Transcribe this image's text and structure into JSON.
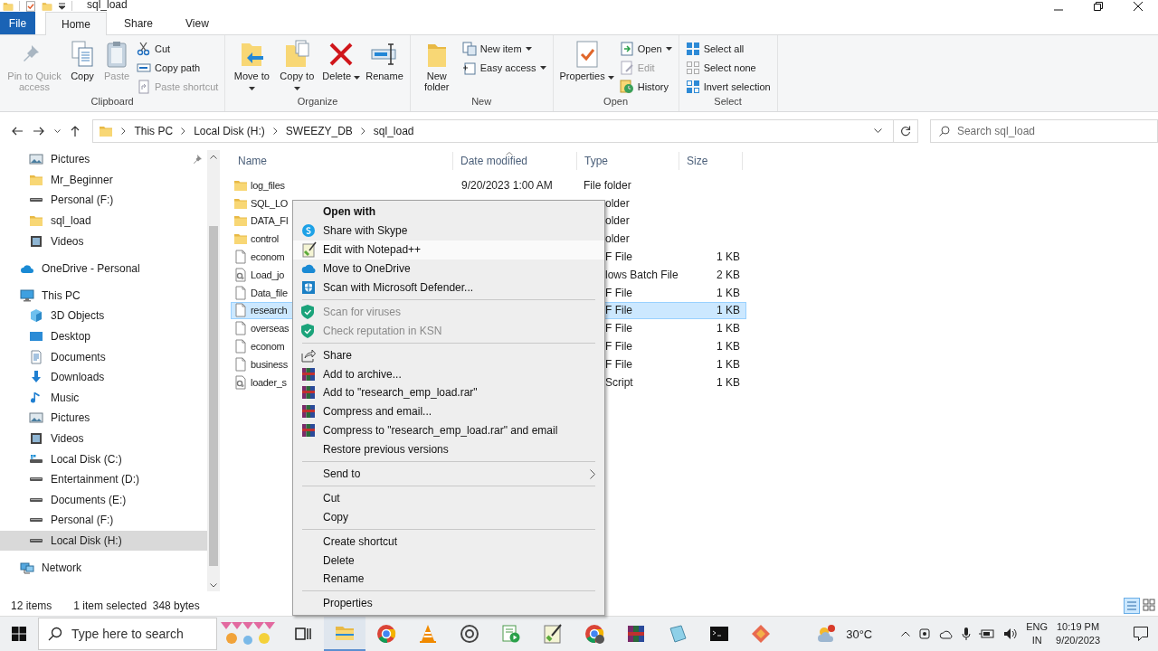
{
  "window": {
    "title": "sql_load"
  },
  "tabs": [
    {
      "label": "File",
      "kind": "file",
      "selected": false
    },
    {
      "label": "Home",
      "kind": "tab",
      "selected": true
    },
    {
      "label": "Share",
      "kind": "tab",
      "selected": false
    },
    {
      "label": "View",
      "kind": "tab",
      "selected": false
    }
  ],
  "ribbon": [
    {
      "label": "Clipboard",
      "items": [
        {
          "kind": "large",
          "label": "Pin to Quick access",
          "disabled": true,
          "dropdown": false
        },
        {
          "kind": "large",
          "label": "Copy",
          "disabled": false,
          "dropdown": false
        },
        {
          "kind": "large",
          "label": "Paste",
          "disabled": true,
          "dropdown": false
        },
        {
          "kind": "small",
          "label": "Cut",
          "disabled": false,
          "dropdown": false
        },
        {
          "kind": "small",
          "label": "Copy path",
          "disabled": false,
          "dropdown": false
        },
        {
          "kind": "small",
          "label": "Paste shortcut",
          "disabled": true,
          "dropdown": false
        }
      ]
    },
    {
      "label": "Organize",
      "items": [
        {
          "kind": "large",
          "label": "Move to",
          "disabled": false,
          "dropdown": true
        },
        {
          "kind": "large",
          "label": "Copy to",
          "disabled": false,
          "dropdown": true
        },
        {
          "kind": "large",
          "label": "Delete",
          "disabled": false,
          "dropdown": true
        },
        {
          "kind": "large",
          "label": "Rename",
          "disabled": false,
          "dropdown": false
        }
      ]
    },
    {
      "label": "New",
      "items": [
        {
          "kind": "large",
          "label": "New folder",
          "disabled": false,
          "dropdown": false
        },
        {
          "kind": "small",
          "label": "New item",
          "disabled": false,
          "dropdown": true
        },
        {
          "kind": "small",
          "label": "Easy access",
          "disabled": false,
          "dropdown": true
        }
      ]
    },
    {
      "label": "Open",
      "items": [
        {
          "kind": "large",
          "label": "Properties",
          "disabled": false,
          "dropdown": true
        },
        {
          "kind": "small",
          "label": "Open",
          "disabled": false,
          "dropdown": true
        },
        {
          "kind": "small",
          "label": "Edit",
          "disabled": true,
          "dropdown": false
        },
        {
          "kind": "small",
          "label": "History",
          "disabled": false,
          "dropdown": false
        }
      ]
    },
    {
      "label": "Select",
      "items": [
        {
          "kind": "small",
          "label": "Select all",
          "disabled": false,
          "dropdown": false
        },
        {
          "kind": "small",
          "label": "Select none",
          "disabled": false,
          "dropdown": false
        },
        {
          "kind": "small",
          "label": "Invert selection",
          "disabled": false,
          "dropdown": false
        }
      ]
    }
  ],
  "address": {
    "crumbs": [
      "This PC",
      "Local Disk (H:)",
      "SWEEZY_DB",
      "sql_load"
    ],
    "search_placeholder": "Search sql_load"
  },
  "nav": [
    {
      "children": [
        {
          "label": "Pictures",
          "pinned": true,
          "selected": false
        },
        {
          "label": "Mr_Beginner",
          "pinned": false,
          "selected": false
        },
        {
          "label": "Personal (F:)",
          "pinned": false,
          "selected": false
        },
        {
          "label": "sql_load",
          "pinned": false,
          "selected": false
        },
        {
          "label": "Videos",
          "pinned": false,
          "selected": false
        }
      ]
    },
    {
      "label": "OneDrive - Personal",
      "selected": false
    },
    {
      "label": "This PC",
      "selected": false,
      "children": [
        {
          "label": "3D Objects",
          "selected": false
        },
        {
          "label": "Desktop",
          "selected": false
        },
        {
          "label": "Documents",
          "selected": false
        },
        {
          "label": "Downloads",
          "selected": false
        },
        {
          "label": "Music",
          "selected": false
        },
        {
          "label": "Pictures",
          "selected": false
        },
        {
          "label": "Videos",
          "selected": false
        },
        {
          "label": "Local Disk (C:)",
          "selected": false
        },
        {
          "label": "Entertainment (D:)",
          "selected": false
        },
        {
          "label": "Documents (E:)",
          "selected": false
        },
        {
          "label": "Personal (F:)",
          "selected": false
        },
        {
          "label": "Local Disk (H:)",
          "selected": true
        }
      ]
    },
    {
      "label": "Network",
      "selected": false
    }
  ],
  "columns": [
    {
      "label": "Name",
      "sorted": false
    },
    {
      "label": "Date modified",
      "sorted": true
    },
    {
      "label": "Type",
      "sorted": false
    },
    {
      "label": "Size",
      "sorted": false
    }
  ],
  "files": [
    {
      "kind": "folder",
      "name": "log_files",
      "date": "9/20/2023 1:00 AM",
      "type": "File folder",
      "selected": false
    },
    {
      "kind": "folder",
      "name": "SQL_LO",
      "type": "older",
      "selected": false
    },
    {
      "kind": "folder",
      "name": "DATA_FI",
      "type": "older",
      "selected": false
    },
    {
      "kind": "folder",
      "name": "control",
      "type": "older",
      "selected": false
    },
    {
      "kind": "file",
      "name": "econom",
      "type": "F File",
      "size": "1 KB",
      "selected": false
    },
    {
      "kind": "batch",
      "name": "Load_jo",
      "type": "lows Batch File",
      "size": "2 KB",
      "selected": false
    },
    {
      "kind": "file",
      "name": "Data_file",
      "type": "F File",
      "size": "1 KB",
      "selected": false
    },
    {
      "kind": "file",
      "name": "research",
      "type": "F File",
      "size": "1 KB",
      "selected": true
    },
    {
      "kind": "file",
      "name": "overseas",
      "type": "F File",
      "size": "1 KB",
      "selected": false
    },
    {
      "kind": "file",
      "name": "econom",
      "type": "F File",
      "size": "1 KB",
      "selected": false
    },
    {
      "kind": "file",
      "name": "business",
      "type": "F File",
      "size": "1 KB",
      "selected": false
    },
    {
      "kind": "batch",
      "name": "loader_s",
      "type": "Script",
      "size": "1 KB",
      "selected": false
    }
  ],
  "context_menu": [
    {
      "kind": "item",
      "label": "Open with",
      "default": true,
      "disabled": false,
      "selected": false
    },
    {
      "kind": "item",
      "label": "Share with Skype",
      "default": false,
      "disabled": false,
      "selected": false
    },
    {
      "kind": "item",
      "label": "Edit with Notepad++",
      "default": false,
      "disabled": false,
      "selected": true
    },
    {
      "kind": "item",
      "label": "Move to OneDrive",
      "default": false,
      "disabled": false,
      "selected": false
    },
    {
      "kind": "item",
      "label": "Scan with Microsoft Defender...",
      "default": false,
      "disabled": false,
      "selected": false
    },
    {
      "kind": "separator"
    },
    {
      "kind": "item",
      "label": "Scan for viruses",
      "default": false,
      "disabled": true,
      "selected": false
    },
    {
      "kind": "item",
      "label": "Check reputation in KSN",
      "default": false,
      "disabled": true,
      "selected": false
    },
    {
      "kind": "separator"
    },
    {
      "kind": "item",
      "label": "Share",
      "default": false,
      "disabled": false,
      "selected": false
    },
    {
      "kind": "item",
      "label": "Add to archive...",
      "default": false,
      "disabled": false,
      "selected": false
    },
    {
      "kind": "item",
      "label": "Add to \"research_emp_load.rar\"",
      "default": false,
      "disabled": false,
      "selected": false
    },
    {
      "kind": "item",
      "label": "Compress and email...",
      "default": false,
      "disabled": false,
      "selected": false
    },
    {
      "kind": "item",
      "label": "Compress to \"research_emp_load.rar\" and email",
      "default": false,
      "disabled": false,
      "selected": false
    },
    {
      "kind": "item",
      "label": "Restore previous versions",
      "default": false,
      "disabled": false,
      "selected": false
    },
    {
      "kind": "separator"
    },
    {
      "kind": "submenu",
      "label": "Send to",
      "default": false,
      "disabled": false,
      "selected": false
    },
    {
      "kind": "separator"
    },
    {
      "kind": "item",
      "label": "Cut",
      "default": false,
      "disabled": false,
      "selected": false
    },
    {
      "kind": "item",
      "label": "Copy",
      "default": false,
      "disabled": false,
      "selected": false
    },
    {
      "kind": "separator"
    },
    {
      "kind": "item",
      "label": "Create shortcut",
      "default": false,
      "disabled": false,
      "selected": false
    },
    {
      "kind": "item",
      "label": "Delete",
      "default": false,
      "disabled": false,
      "selected": false
    },
    {
      "kind": "item",
      "label": "Rename",
      "default": false,
      "disabled": false,
      "selected": false
    },
    {
      "kind": "separator"
    },
    {
      "kind": "item",
      "label": "Properties",
      "default": false,
      "disabled": false,
      "selected": false
    }
  ],
  "status_bar": {
    "count": "12 items",
    "selection": "1 item selected  348 bytes"
  },
  "taskbar": {
    "search_placeholder": "Type here to search",
    "temperature": "30°C",
    "language": "ENG",
    "region": "IN",
    "time": "10:19 PM",
    "date": "9/20/2023"
  }
}
